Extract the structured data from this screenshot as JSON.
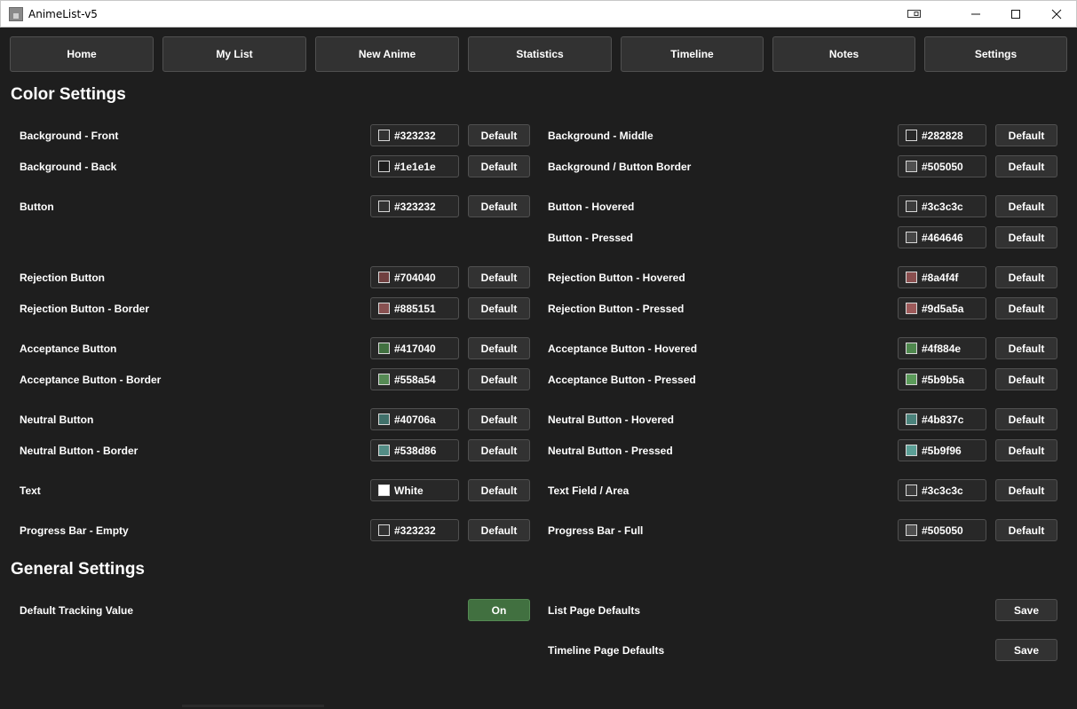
{
  "window": {
    "title": "AnimeList-v5"
  },
  "nav": [
    {
      "label": "Home"
    },
    {
      "label": "My List"
    },
    {
      "label": "New Anime"
    },
    {
      "label": "Statistics"
    },
    {
      "label": "Timeline"
    },
    {
      "label": "Notes"
    },
    {
      "label": "Settings"
    }
  ],
  "color_settings": {
    "title": "Color Settings",
    "default_label": "Default",
    "left": [
      {
        "label": "Background - Front",
        "value": "#323232",
        "swatch": "#323232"
      },
      {
        "label": "Background - Back",
        "value": "#1e1e1e",
        "swatch": "#1e1e1e"
      },
      {
        "label": "Button",
        "value": "#323232",
        "swatch": "#323232"
      },
      {
        "label": "Rejection Button",
        "value": "#704040",
        "swatch": "#704040"
      },
      {
        "label": "Rejection Button - Border",
        "value": "#885151",
        "swatch": "#885151"
      },
      {
        "label": "Acceptance Button",
        "value": "#417040",
        "swatch": "#417040"
      },
      {
        "label": "Acceptance Button - Border",
        "value": "#558a54",
        "swatch": "#558a54"
      },
      {
        "label": "Neutral Button",
        "value": "#40706a",
        "swatch": "#40706a"
      },
      {
        "label": "Neutral Button - Border",
        "value": "#538d86",
        "swatch": "#538d86"
      },
      {
        "label": "Text",
        "value": "White",
        "swatch": "#ffffff"
      },
      {
        "label": "Progress Bar - Empty",
        "value": "#323232",
        "swatch": "#323232"
      }
    ],
    "right": [
      {
        "label": "Background - Middle",
        "value": "#282828",
        "swatch": "#282828"
      },
      {
        "label": "Background / Button Border",
        "value": "#505050",
        "swatch": "#505050"
      },
      {
        "label": "Button - Hovered",
        "value": "#3c3c3c",
        "swatch": "#3c3c3c"
      },
      {
        "label": "Button - Pressed",
        "value": "#464646",
        "swatch": "#464646"
      },
      {
        "label": "Rejection Button - Hovered",
        "value": "#8a4f4f",
        "swatch": "#8a4f4f"
      },
      {
        "label": "Rejection Button - Pressed",
        "value": "#9d5a5a",
        "swatch": "#9d5a5a"
      },
      {
        "label": "Acceptance Button - Hovered",
        "value": "#4f884e",
        "swatch": "#4f884e"
      },
      {
        "label": "Acceptance Button - Pressed",
        "value": "#5b9b5a",
        "swatch": "#5b9b5a"
      },
      {
        "label": "Neutral Button - Hovered",
        "value": "#4b837c",
        "swatch": "#4b837c"
      },
      {
        "label": "Neutral Button - Pressed",
        "value": "#5b9f96",
        "swatch": "#5b9f96"
      },
      {
        "label": "Text Field / Area",
        "value": "#3c3c3c",
        "swatch": "#3c3c3c"
      },
      {
        "label": "Progress Bar - Full",
        "value": "#505050",
        "swatch": "#505050"
      }
    ]
  },
  "general_settings": {
    "title": "General Settings",
    "tracking": {
      "label": "Default Tracking Value",
      "toggle": "On"
    },
    "list_defaults": {
      "label": "List Page Defaults",
      "button": "Save"
    },
    "timeline_defaults": {
      "label": "Timeline Page Defaults",
      "button": "Save"
    }
  }
}
